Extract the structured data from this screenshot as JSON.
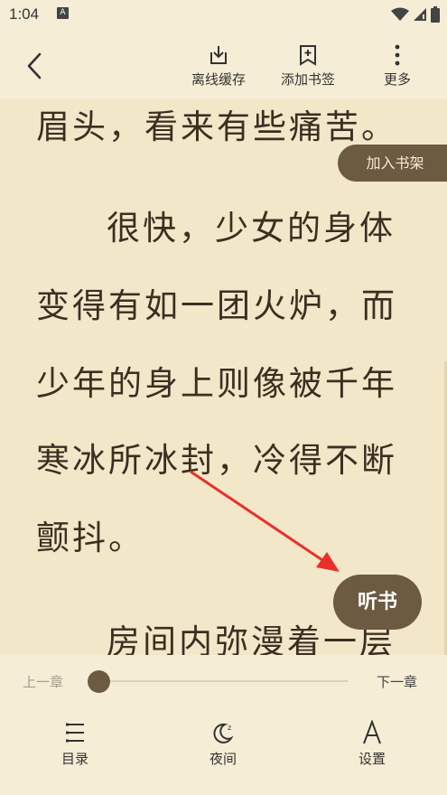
{
  "status": {
    "time": "1:04",
    "notification_letter": "A"
  },
  "toolbar": {
    "offline_label": "离线缓存",
    "bookmark_label": "添加书签",
    "more_label": "更多"
  },
  "content": {
    "lines": [
      "眉头，看来有些痛苦。",
      "很快，少女的身体",
      "变得有如一团火炉，而",
      "少年的身上则像被千年",
      "寒冰所冰封，冷得不断",
      "颤抖。",
      "房间内弥漫着一层"
    ]
  },
  "add_shelf_label": "加入书架",
  "listen_label": "听书",
  "progress": {
    "prev_label": "上一章",
    "next_label": "下一章",
    "position": 0.0
  },
  "bottom_nav": {
    "toc_label": "目录",
    "night_label": "夜间",
    "settings_label": "设置"
  },
  "colors": {
    "background": "#f3e7c9",
    "accent": "#6c5a41",
    "text": "#3b2f22",
    "arrow": "#e8302a"
  }
}
